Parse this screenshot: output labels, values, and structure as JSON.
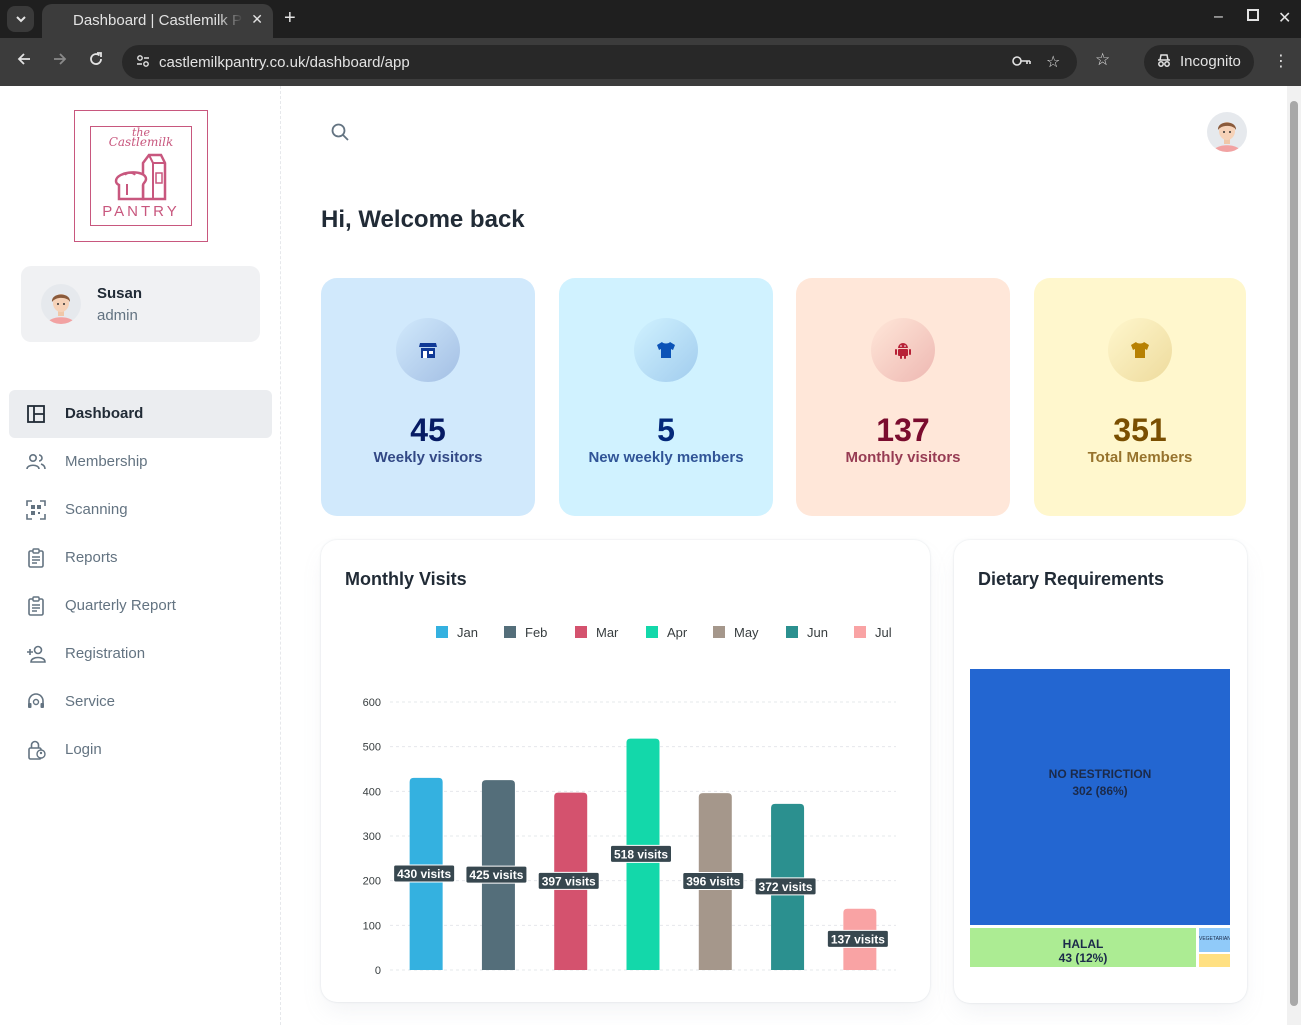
{
  "browser": {
    "tab_title": "Dashboard | Castlemilk Pantry",
    "url": "castlemilkpantry.co.uk/dashboard/app",
    "incognito_label": "Incognito"
  },
  "logo": {
    "the": "the",
    "name": "Castlemilk",
    "word": "PANTRY"
  },
  "user": {
    "name": "Susan",
    "role": "admin"
  },
  "nav": [
    {
      "label": "Dashboard",
      "icon": "dashboard-icon",
      "active": true
    },
    {
      "label": "Membership",
      "icon": "people-icon"
    },
    {
      "label": "Scanning",
      "icon": "qr-scan-icon"
    },
    {
      "label": "Reports",
      "icon": "clipboard-icon"
    },
    {
      "label": "Quarterly Report",
      "icon": "clipboard-icon"
    },
    {
      "label": "Registration",
      "icon": "person-add-icon"
    },
    {
      "label": "Service",
      "icon": "headset-icon"
    },
    {
      "label": "Login",
      "icon": "lock-person-icon"
    }
  ],
  "welcome": "Hi, Welcome back",
  "stats": [
    {
      "value": "45",
      "label": "Weekly visitors",
      "icon": "store-icon",
      "bg": "#d1e9fc",
      "fg": "#061b64",
      "accent": "#103996"
    },
    {
      "value": "5",
      "label": "New weekly members",
      "icon": "shirt-icon",
      "bg": "#d0f2ff",
      "fg": "#04297a",
      "accent": "#0c53b7"
    },
    {
      "value": "137",
      "label": "Monthly visitors",
      "icon": "android-icon",
      "bg": "#ffe7d9",
      "fg": "#7a0c2e",
      "accent": "#b72136"
    },
    {
      "value": "351",
      "label": "Total Members",
      "icon": "shirt-icon",
      "bg": "#fff7cd",
      "fg": "#7a4f01",
      "accent": "#b78103"
    }
  ],
  "monthly_title": "Monthly Visits",
  "dietary_title": "Dietary Requirements",
  "chart_data": [
    {
      "type": "bar",
      "title": "Monthly Visits",
      "categories": [
        "Jan",
        "Feb",
        "Mar",
        "Apr",
        "May",
        "Jun",
        "Jul"
      ],
      "values": [
        430,
        425,
        397,
        518,
        396,
        372,
        137
      ],
      "colors": [
        "#34b1e0",
        "#546e7a",
        "#d4526e",
        "#13d8aa",
        "#a5978b",
        "#2b908f",
        "#f9a3a4"
      ],
      "data_labels": [
        "430 visits",
        "425 visits",
        "397 visits",
        "518 visits",
        "396 visits",
        "372 visits",
        "137 visits"
      ],
      "yticks": [
        0,
        100,
        200,
        300,
        400,
        500,
        600
      ],
      "ylim": [
        0,
        600
      ],
      "legend": [
        "Jan",
        "Feb",
        "Mar",
        "Apr",
        "May",
        "Jun",
        "Jul"
      ],
      "legend_position": "top",
      "grid": true
    },
    {
      "type": "treemap",
      "title": "Dietary Requirements",
      "items": [
        {
          "label": "NO RESTRICTION",
          "value": 302,
          "detail": "302 (86%)",
          "color": "#2366d1"
        },
        {
          "label": "HALAL",
          "value": 43,
          "detail": "43 (12%)",
          "color": "#acec93"
        },
        {
          "label": "VEGETARIAN",
          "value": 4,
          "color": "#90caf9"
        },
        {
          "label": "",
          "value": 2,
          "color": "#ffe082"
        }
      ]
    }
  ]
}
